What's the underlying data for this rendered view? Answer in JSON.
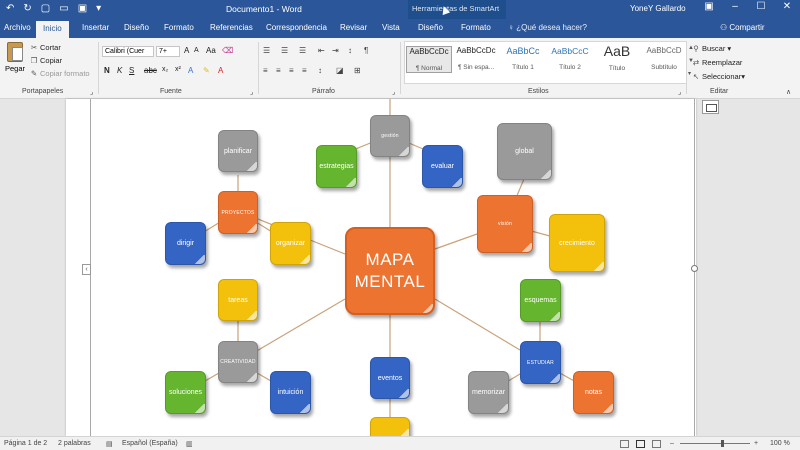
{
  "window": {
    "doc_title": "Documento1 - Word",
    "context_label": "Herramientas de SmartArt",
    "user": "YoneY Gallardo",
    "share": "Compartir",
    "tell_me": "¿Qué desea hacer?"
  },
  "tabs": [
    "Archivo",
    "Inicio",
    "Insertar",
    "Diseño",
    "Formato",
    "Referencias",
    "Correspondencia",
    "Revisar",
    "Vista",
    "Diseño",
    "Formato"
  ],
  "ribbon": {
    "clipboard": {
      "paste": "Pegar",
      "cut": "Cortar",
      "copy": "Copiar",
      "format_painter": "Copiar formato",
      "label": "Portapapeles"
    },
    "font": {
      "name": "Calibri (Cuer",
      "size": "7+",
      "label": "Fuente"
    },
    "paragraph": {
      "label": "Párrafo"
    },
    "styles": {
      "label": "Estilos",
      "items": [
        {
          "preview": "AaBbCcDc",
          "name": "¶ Normal"
        },
        {
          "preview": "AaBbCcDc",
          "name": "¶ Sin espa..."
        },
        {
          "preview": "AaBbCc",
          "name": "Título 1"
        },
        {
          "preview": "AaBbCcC",
          "name": "Título 2"
        },
        {
          "preview": "AaB",
          "name": "Título"
        },
        {
          "preview": "AaBbCcD",
          "name": "Subtítulo"
        }
      ]
    },
    "editing": {
      "label": "Editar",
      "find": "Buscar",
      "replace": "Reemplazar",
      "select": "Seleccionar"
    }
  },
  "mindmap": {
    "center": "MAPA MENTAL",
    "nodes": {
      "planificar": "planificar",
      "proyectos": "PROYECTOS",
      "dirigir": "dirigir",
      "organizar": "organizar",
      "tareas": "tareas",
      "creatividad": "CREATIVIDAD",
      "soluciones": "soluciones",
      "intuicion": "intuición",
      "estrategias": "estrategias",
      "gestion": "gestión",
      "evaluar": "evaluar",
      "global": "global",
      "vision": "visión",
      "crecimiento": "crecimiento",
      "esquemas": "esquemas",
      "estudiar": "ESTUDIAR",
      "memorizar": "memorizar",
      "notas": "notas",
      "eventos": "eventos",
      "bottom": ""
    }
  },
  "status": {
    "page": "Página 1 de 2",
    "words": "2 palabras",
    "language": "Español (España)",
    "zoom": "100 %"
  }
}
